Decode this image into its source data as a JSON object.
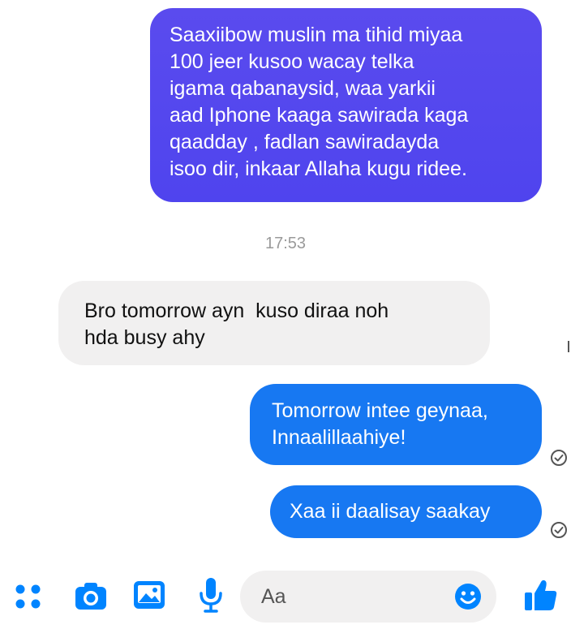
{
  "conversation": {
    "messages": [
      {
        "direction": "outgoing",
        "text": "Saaxiibow muslin ma tihid miyaa\n100 jeer kusoo wacay telka\nigama qabanaysid, waa yarkii\naad Iphone kaaga sawirada kaga\nqaadday , fadlan sawiradayda\nisoo dir, inkaar Allaha kugu ridee."
      },
      {
        "direction": "incoming",
        "text": "Bro tomorrow ayn  kuso diraa noh\nhda busy ahy"
      },
      {
        "direction": "outgoing",
        "text": "Tomorrow intee geynaa,\nInnaalillaahiye!",
        "status_icon": "read-check-icon"
      },
      {
        "direction": "outgoing",
        "text": "Xaa ii daalisay saakay",
        "status_icon": "read-check-icon"
      }
    ],
    "timestamp": "17:53"
  },
  "composer": {
    "placeholder": "Aa",
    "icons": [
      "apps-grid-icon",
      "camera-icon",
      "photo-icon",
      "microphone-icon",
      "emoji-icon",
      "thumbs-up-icon"
    ]
  },
  "colors": {
    "outgoing_first": "#5048ee",
    "outgoing": "#1778f2",
    "incoming": "#f1f0f0",
    "accent": "#0084ff"
  }
}
